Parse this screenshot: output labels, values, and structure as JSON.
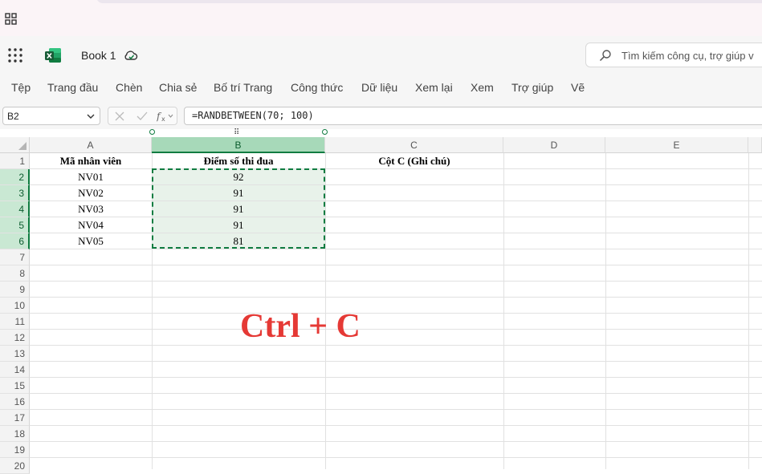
{
  "app": {
    "book_title": "Book 1",
    "search_placeholder": "Tìm kiếm công cụ, trợ giúp v"
  },
  "ribbon": {
    "tabs": [
      "Tệp",
      "Trang đầu",
      "Chèn",
      "Chia sẻ",
      "Bố trí Trang",
      "Công thức",
      "Dữ liệu",
      "Xem lại",
      "Xem",
      "Trợ giúp",
      "Vẽ"
    ]
  },
  "formula_bar": {
    "name_box": "B2",
    "formula": "=RANDBETWEEN(70; 100)"
  },
  "grid": {
    "columns": [
      "A",
      "B",
      "C",
      "D",
      "E"
    ],
    "rows": [
      "1",
      "2",
      "3",
      "4",
      "5",
      "6",
      "7",
      "8",
      "9",
      "10",
      "11",
      "12",
      "13",
      "14",
      "15",
      "16",
      "17",
      "18",
      "19",
      "20"
    ],
    "selected_column": "B",
    "selected_rows": [
      "2",
      "3",
      "4",
      "5",
      "6"
    ],
    "headers": {
      "A1": "Mã nhân viên",
      "B1": "Điểm số thi đua",
      "C1": "Cột C (Ghi chú)"
    },
    "data_rows": [
      {
        "A": "NV01",
        "B": "92"
      },
      {
        "A": "NV02",
        "B": "91"
      },
      {
        "A": "NV03",
        "B": "91"
      },
      {
        "A": "NV04",
        "B": "91"
      },
      {
        "A": "NV05",
        "B": "81"
      }
    ]
  },
  "annotation": {
    "text": "Ctrl + C",
    "color": "#e53935"
  },
  "colors": {
    "excel_green": "#107c41",
    "selection_fill": "#e8f2ea"
  }
}
